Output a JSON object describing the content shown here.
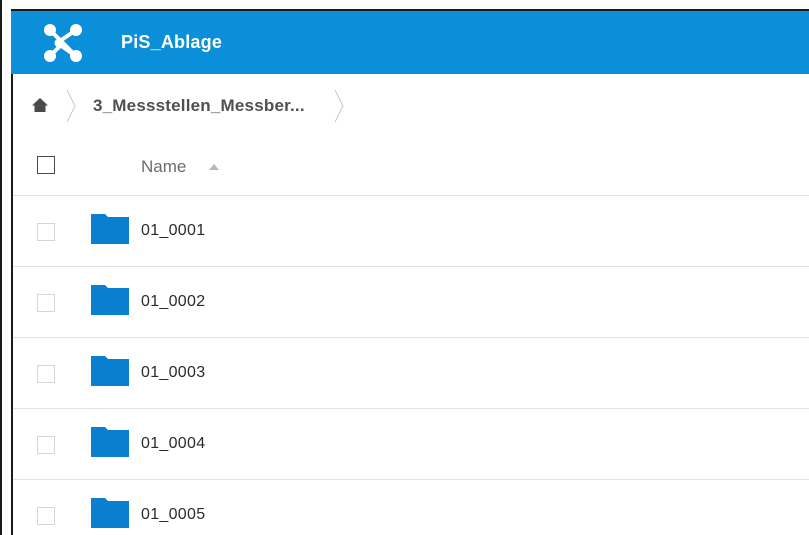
{
  "app": {
    "title": "PiS_Ablage",
    "accent_color": "#0a8fd8",
    "logo_icon": "share-network-icon"
  },
  "breadcrumb": {
    "home_icon": "home-icon",
    "current": "3_Messstellen_Messber..."
  },
  "list": {
    "name_column_label": "Name",
    "sort_direction": "ascending",
    "items": [
      {
        "label": "01_0001",
        "icon": "folder-icon"
      },
      {
        "label": "01_0002",
        "icon": "folder-icon"
      },
      {
        "label": "01_0003",
        "icon": "folder-icon"
      },
      {
        "label": "01_0004",
        "icon": "folder-icon"
      },
      {
        "label": "01_0005",
        "icon": "folder-icon"
      }
    ]
  }
}
